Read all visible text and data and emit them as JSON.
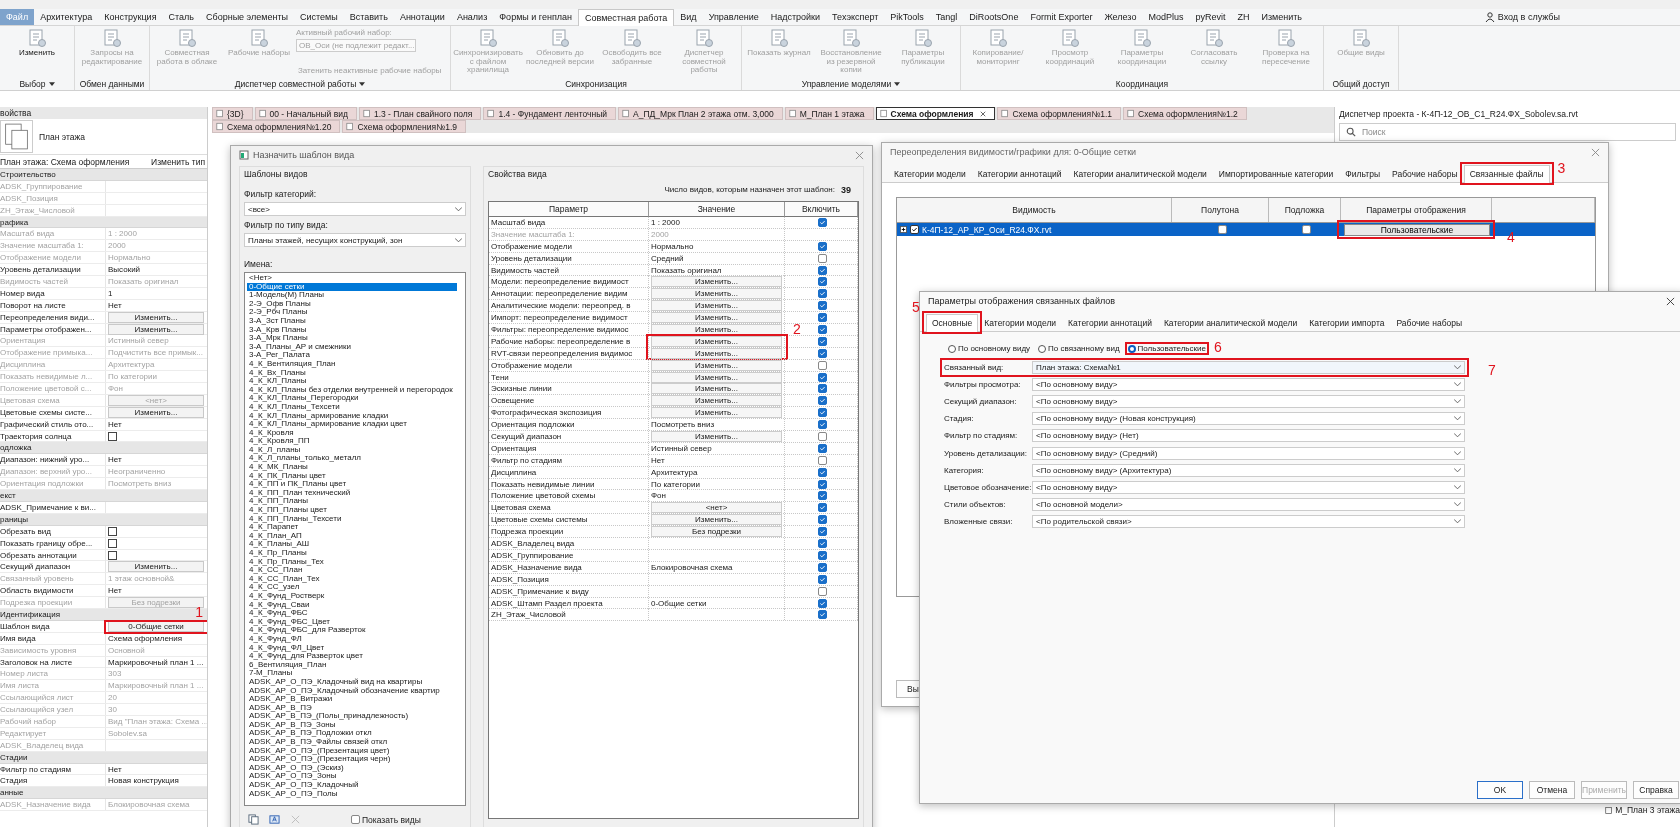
{
  "menu_tabs": [
    {
      "label": "Файл",
      "selected": false,
      "kind": "file"
    },
    {
      "label": "Архитектура",
      "selected": false,
      "kind": "tab"
    },
    {
      "label": "Конструкция",
      "selected": false,
      "kind": "tab"
    },
    {
      "label": "Сталь",
      "selected": false,
      "kind": "tab"
    },
    {
      "label": "Сборные элементы",
      "selected": false,
      "kind": "tab"
    },
    {
      "label": "Системы",
      "selected": false,
      "kind": "tab"
    },
    {
      "label": "Вставить",
      "selected": false,
      "kind": "tab"
    },
    {
      "label": "Аннотации",
      "selected": false,
      "kind": "tab"
    },
    {
      "label": "Анализ",
      "selected": false,
      "kind": "tab"
    },
    {
      "label": "Формы и генплан",
      "selected": false,
      "kind": "tab"
    },
    {
      "label": "Совместная работа",
      "selected": true,
      "kind": "tab"
    },
    {
      "label": "Вид",
      "selected": false,
      "kind": "tab"
    },
    {
      "label": "Управление",
      "selected": false,
      "kind": "tab"
    },
    {
      "label": "Надстройки",
      "selected": false,
      "kind": "tab"
    },
    {
      "label": "Техэксперт",
      "selected": false,
      "kind": "tab"
    },
    {
      "label": "PikTools",
      "selected": false,
      "kind": "tab"
    },
    {
      "label": "Tangl",
      "selected": false,
      "kind": "tab"
    },
    {
      "label": "DiRootsOne",
      "selected": false,
      "kind": "tab"
    },
    {
      "label": "Formit Exporter",
      "selected": false,
      "kind": "tab"
    },
    {
      "label": "Железо",
      "selected": false,
      "kind": "tab"
    },
    {
      "label": "ModPlus",
      "selected": false,
      "kind": "tab"
    },
    {
      "label": "pyRevit",
      "selected": false,
      "kind": "tab"
    },
    {
      "label": "ZH",
      "selected": false,
      "kind": "tab"
    },
    {
      "label": "Изменить",
      "selected": false,
      "kind": "tab"
    }
  ],
  "account": "Вход в службы",
  "ribbon_panels": [
    {
      "label": "Выбор",
      "menu": true,
      "items": [
        {
          "kind": "button",
          "label": "Изменить",
          "disabled": false
        }
      ]
    },
    {
      "label": "Обмен данными",
      "menu": false,
      "items": [
        {
          "kind": "button",
          "label": "Запросы на редактирование",
          "disabled": true
        }
      ]
    },
    {
      "label": "Диспетчер совместной работы",
      "menu": true,
      "items": [
        {
          "kind": "button",
          "label": "Совместная работа в облаке",
          "disabled": true
        },
        {
          "kind": "button",
          "label": "Рабочие наборы",
          "disabled": true
        },
        {
          "kind": "combo",
          "label": "Активный рабочий набор:",
          "value": "ОВ_Оси (не подлежит редакт...",
          "disabled": true
        },
        {
          "kind": "toggle",
          "label": "Затенить неактивные рабочие наборы",
          "disabled": true
        }
      ]
    },
    {
      "label": "Синхронизация",
      "menu": false,
      "items": [
        {
          "kind": "button",
          "label": "Синхронизировать с файлом хранилища",
          "disabled": true
        },
        {
          "kind": "button",
          "label": "Обновить до последней версии",
          "disabled": true
        },
        {
          "kind": "button",
          "label": "Освободить все забранные",
          "disabled": true
        },
        {
          "kind": "button",
          "label": "Диспетчер совместной работы",
          "disabled": true
        }
      ]
    },
    {
      "label": "Управление моделями",
      "menu": true,
      "items": [
        {
          "kind": "button",
          "label": "Показать журнал",
          "disabled": true
        },
        {
          "kind": "button",
          "label": "Восстановление из резервной копии",
          "disabled": true
        },
        {
          "kind": "button",
          "label": "Параметры публикации",
          "disabled": true
        }
      ]
    },
    {
      "label": "Координация",
      "menu": false,
      "items": [
        {
          "kind": "button",
          "label": "Копирование/мониторинг",
          "disabled": true
        },
        {
          "kind": "button",
          "label": "Просмотр координаций",
          "disabled": true
        },
        {
          "kind": "button",
          "label": "Параметры координации",
          "disabled": true
        },
        {
          "kind": "button",
          "label": "Согласовать ссылку",
          "disabled": true
        },
        {
          "kind": "button",
          "label": "Проверка на пересечение",
          "disabled": true
        }
      ]
    },
    {
      "label": "Общий доступ",
      "menu": false,
      "items": [
        {
          "kind": "button",
          "label": "Общие виды",
          "disabled": true
        }
      ]
    }
  ],
  "properties": {
    "title": "войства",
    "type_name": "План этажа",
    "instance": "План этажа: Схема оформления",
    "edit_type": "Изменить тип",
    "groups": [
      {
        "title": "Строительство",
        "rows": [
          {
            "name": "ADSK_Группирование",
            "kind": "text",
            "disabled": true
          },
          {
            "name": "ADSK_Позиция",
            "kind": "text",
            "disabled": true
          },
          {
            "name": "ZH_Этаж_Числовой",
            "kind": "text",
            "disabled": true
          }
        ]
      },
      {
        "title": "рафика",
        "rows": [
          {
            "name": "Масштаб вида",
            "kind": "text",
            "value": "1 : 2000",
            "disabled": true
          },
          {
            "name": "Значение масштаба    1:",
            "kind": "text",
            "value": "2000",
            "disabled": true
          },
          {
            "name": "Отображение модели",
            "kind": "text",
            "value": "Нормально",
            "disabled": true
          },
          {
            "name": "Уровень детализации",
            "kind": "text",
            "value": "Высокий",
            "disabled": false
          },
          {
            "name": "Видимость частей",
            "kind": "text",
            "value": "Показать оригинал",
            "disabled": true
          },
          {
            "name": "Номер вида",
            "kind": "text",
            "value": "1",
            "disabled": false
          },
          {
            "name": "Поворот на листе",
            "kind": "text",
            "value": "Нет",
            "disabled": false
          },
          {
            "name": "Переопределения види...",
            "kind": "button",
            "value": "Изменить...",
            "disabled": false
          },
          {
            "name": "Параметры отображен...",
            "kind": "button",
            "value": "Изменить...",
            "disabled": false
          },
          {
            "name": "Ориентация",
            "kind": "text",
            "value": "Истинный север",
            "disabled": true
          },
          {
            "name": "Отображение примыка...",
            "kind": "text",
            "value": "Подчистить все примык...",
            "disabled": true
          },
          {
            "name": "Дисциплина",
            "kind": "text",
            "value": "Архитектура",
            "disabled": true
          },
          {
            "name": "Показать невидимые л...",
            "kind": "text",
            "value": "По категории",
            "disabled": true
          },
          {
            "name": "Положение цветовой с...",
            "kind": "text",
            "value": "Фон",
            "disabled": true
          },
          {
            "name": "Цветовая схема",
            "kind": "button",
            "value": "<нет>",
            "disabled": true
          },
          {
            "name": "Цветовые схемы систе...",
            "kind": "button",
            "value": "Изменить...",
            "disabled": false
          },
          {
            "name": "Графический стиль ото...",
            "kind": "text",
            "value": "Нет",
            "disabled": false
          },
          {
            "name": "Траектория солнца",
            "kind": "check",
            "checked": false,
            "disabled": false
          }
        ]
      },
      {
        "title": "одложка",
        "rows": [
          {
            "name": "Диапазон: нижний уро...",
            "kind": "text",
            "value": "Нет",
            "disabled": false
          },
          {
            "name": "Диапазон: верхний уро...",
            "kind": "text",
            "value": "Неограниченно",
            "disabled": true
          },
          {
            "name": "Ориентация подложки",
            "kind": "text",
            "value": "Посмотреть вниз",
            "disabled": true
          }
        ]
      },
      {
        "title": "екст",
        "rows": [
          {
            "name": "ADSK_Примечание к ви...",
            "kind": "text",
            "disabled": false
          }
        ]
      },
      {
        "title": "раницы",
        "rows": [
          {
            "name": "Обрезать вид",
            "kind": "check",
            "checked": false,
            "disabled": false
          },
          {
            "name": "Показать границу обре...",
            "kind": "check",
            "checked": false,
            "disabled": false
          },
          {
            "name": "Обрезать аннотации",
            "kind": "check",
            "checked": false,
            "disabled": false
          },
          {
            "name": "Секущий диапазон",
            "kind": "button",
            "value": "Изменить...",
            "disabled": false
          },
          {
            "name": "Связанный уровень",
            "kind": "text",
            "value": "1 этаж основной&",
            "disabled": true
          },
          {
            "name": "Область видимости",
            "kind": "text",
            "value": "Нет",
            "disabled": false
          },
          {
            "name": "Подрезка проекции",
            "kind": "button",
            "value": "Без подрезки",
            "disabled": true
          }
        ]
      },
      {
        "title": "Идентификация",
        "rows": [
          {
            "name": "Шаблон вида",
            "kind": "button",
            "value": "0-Общие сетки",
            "disabled": false
          },
          {
            "name": "Имя вида",
            "kind": "text",
            "value": "Схема оформления",
            "disabled": false
          },
          {
            "name": "Зависимость уровня",
            "kind": "text",
            "value": "Основной",
            "disabled": true
          },
          {
            "name": "Заголовок на листе",
            "kind": "text",
            "value": "Маркировочный план 1 ...",
            "disabled": false
          },
          {
            "name": "Номер листа",
            "kind": "text",
            "value": "303",
            "disabled": true
          },
          {
            "name": "Имя листа",
            "kind": "text",
            "value": "Маркировочный план 1 ...",
            "disabled": true
          },
          {
            "name": "Ссылающийся лист",
            "kind": "text",
            "value": "20",
            "disabled": true
          },
          {
            "name": "Ссылающийся узел",
            "kind": "text",
            "value": "30",
            "disabled": true
          },
          {
            "name": "Рабочий набор",
            "kind": "text",
            "value": "Вид \"План этажа: Схема ...",
            "disabled": true
          },
          {
            "name": "Редактирует",
            "kind": "text",
            "value": "Sobolev.sa",
            "disabled": true
          },
          {
            "name": "ADSK_Владелец вида",
            "kind": "text",
            "disabled": true
          }
        ]
      },
      {
        "title": "Стадии",
        "rows": [
          {
            "name": "Фильтр по стадиям",
            "kind": "text",
            "value": "Нет",
            "disabled": false
          },
          {
            "name": "Стадия",
            "kind": "text",
            "value": "Новая конструкция",
            "disabled": false
          }
        ]
      },
      {
        "title": "анные",
        "rows": [
          {
            "name": "ADSK_Назначение вида",
            "kind": "text",
            "value": "Блокировочная схема",
            "disabled": true
          }
        ]
      }
    ]
  },
  "view_tab_rows": [
    {
      "tabs": [
        {
          "label": "{3D}",
          "selected": false
        },
        {
          "label": "00 - Начальный вид",
          "selected": false
        },
        {
          "label": "1.3 - План свайного поля",
          "selected": false
        },
        {
          "label": "1.4 - Фундамент ленточный",
          "selected": false
        },
        {
          "label": "А_ПД_Мрк План 2 этажа отм. 3,000",
          "selected": false
        },
        {
          "label": "М_План 1 этажа",
          "selected": false
        },
        {
          "label": "Схема оформления",
          "selected": true
        },
        {
          "label": "Схема оформления№1.1",
          "selected": false
        },
        {
          "label": "Схема оформления№1.2",
          "selected": false
        }
      ]
    },
    {
      "tabs": [
        {
          "label": "Схема оформления№1.20",
          "selected": false
        },
        {
          "label": "Схема оформления№1.9",
          "selected": false
        }
      ]
    }
  ],
  "project_browser": {
    "title": "Диспетчер проекта - К-4П-12_ОВ_С1_R24.ФХ_Sobolev.sa.rvt",
    "search": {
      "placeholder": "Поиск"
    },
    "items": [
      {
        "label": "М_План 3 этажа"
      }
    ]
  },
  "assign_template_dialog": {
    "title": "Назначить шаблон вида",
    "templates_group": "Шаблоны видов",
    "category_filter_label": "Фильтр категорий:",
    "category_filter": "<все>",
    "view_type_filter_label": "Фильтр по типу вида:",
    "view_type_filter": "Планы этажей, несущих конструкций, зон",
    "names_label": "Имена:",
    "names": [
      {
        "name": "<Нет>",
        "selected": false
      },
      {
        "name": "0-Общие сетки",
        "selected": true
      },
      {
        "name": "1-Модель(М) Планы",
        "selected": false
      },
      {
        "name": "2-Э_Офв Планы",
        "selected": false
      },
      {
        "name": "2-Э_Рбч Планы",
        "selected": false
      },
      {
        "name": "3-А_Зст Планы",
        "selected": false
      },
      {
        "name": "3-А_Крв Планы",
        "selected": false
      },
      {
        "name": "3-А_Мрк Планы",
        "selected": false
      },
      {
        "name": "3-А_Планы_АР и смежники",
        "selected": false
      },
      {
        "name": "3-А_Рег_Палата",
        "selected": false
      },
      {
        "name": "4_К_Вентиляция_План",
        "selected": false
      },
      {
        "name": "4_К_Вх_Планы",
        "selected": false
      },
      {
        "name": "4_К_КЛ_Планы",
        "selected": false
      },
      {
        "name": "4_К_КЛ_Планы без отделки внутренней и перегородок",
        "selected": false
      },
      {
        "name": "4_К_КЛ_Планы_Перегородки",
        "selected": false
      },
      {
        "name": "4_К_КЛ_Планы_Техсети",
        "selected": false
      },
      {
        "name": "4_К_КЛ_Планы_армирование кладки",
        "selected": false
      },
      {
        "name": "4_К_КЛ_Планы_армирование кладки цвет",
        "selected": false
      },
      {
        "name": "4_К_Кровля",
        "selected": false
      },
      {
        "name": "4_К_Кровля_ПП",
        "selected": false
      },
      {
        "name": "4_К_Л_планы",
        "selected": false
      },
      {
        "name": "4_К_Л_планы_только_металл",
        "selected": false
      },
      {
        "name": "4_К_МК_Планы",
        "selected": false
      },
      {
        "name": "4_К_ПК_Планы цвет",
        "selected": false
      },
      {
        "name": "4_К_ПП и ПК_Планы цвет",
        "selected": false
      },
      {
        "name": "4_К_ПП_План технический",
        "selected": false
      },
      {
        "name": "4_К_ПП_Планы",
        "selected": false
      },
      {
        "name": "4_К_ПП_Планы цвет",
        "selected": false
      },
      {
        "name": "4_К_ПП_Планы_Техсети",
        "selected": false
      },
      {
        "name": "4_К_Парапет",
        "selected": false
      },
      {
        "name": "4_К_План_АП",
        "selected": false
      },
      {
        "name": "4_К_Планы_АШ",
        "selected": false
      },
      {
        "name": "4_К_Пр_Планы",
        "selected": false
      },
      {
        "name": "4_К_Пр_Планы_Тех",
        "selected": false
      },
      {
        "name": "4_К_СС_План",
        "selected": false
      },
      {
        "name": "4_К_СС_План_Тех",
        "selected": false
      },
      {
        "name": "4_К_СС_узел",
        "selected": false
      },
      {
        "name": "4_К_Фунд_Ростверк",
        "selected": false
      },
      {
        "name": "4_К_Фунд_Сваи",
        "selected": false
      },
      {
        "name": "4_К_Фунд_ФБС",
        "selected": false
      },
      {
        "name": "4_К_Фунд_ФБС_Цвет",
        "selected": false
      },
      {
        "name": "4_К_Фунд_ФБС_для Разверток",
        "selected": false
      },
      {
        "name": "4_К_Фунд_ФЛ",
        "selected": false
      },
      {
        "name": "4_К_Фунд_ФЛ_Цвет",
        "selected": false
      },
      {
        "name": "4_К_Фунд_для Разверток цвет",
        "selected": false
      },
      {
        "name": "6_Вентиляция_План",
        "selected": false
      },
      {
        "name": "7-М_Планы",
        "selected": false
      },
      {
        "name": "ADSK_АР_О_ПЭ_Кладочный вид на квартиры",
        "selected": false
      },
      {
        "name": "ADSK_АР_О_ПЭ_Кладочный обозначение квартир",
        "selected": false
      },
      {
        "name": "ADSK_АР_В_Витражи",
        "selected": false
      },
      {
        "name": "ADSK_АР_В_ПЭ",
        "selected": false
      },
      {
        "name": "ADSK_АР_В_ПЭ_(Полы_принадлежность)",
        "selected": false
      },
      {
        "name": "ADSK_АР_В_ПЭ_Зоны",
        "selected": false
      },
      {
        "name": "ADSK_АР_В_ПЭ_Подложки откл",
        "selected": false
      },
      {
        "name": "ADSK_АР_В_ПЭ_Файлы связей откл",
        "selected": false
      },
      {
        "name": "ADSK_АР_О_ПЭ_(Презентация цвет)",
        "selected": false
      },
      {
        "name": "ADSK_АР_О_ПЭ_(Презентация черн)",
        "selected": false
      },
      {
        "name": "ADSK_АР_О_ПЭ_(Эскиз)",
        "selected": false
      },
      {
        "name": "ADSK_АР_О_ПЭ_Зоны",
        "selected": false
      },
      {
        "name": "ADSK_АР_О_ПЭ_Кладочный",
        "selected": false
      },
      {
        "name": "ADSK_АР_О_ПЭ_Полы",
        "selected": false
      }
    ],
    "show_views": {
      "label": "Показать виды",
      "checked": false
    },
    "properties_group": "Свойства вида",
    "count_label": "Число видов, которым назначен этот шаблон:",
    "count": "39",
    "columns": [
      "Параметр",
      "Значение",
      "Включить"
    ],
    "rows": [
      {
        "parameter": "Масштаб вида",
        "kind": "text",
        "value": "1 : 2000",
        "disabled": false,
        "included": true
      },
      {
        "parameter": "Значение масштаба    1:",
        "kind": "text",
        "value": "2000",
        "disabled": true
      },
      {
        "parameter": "Отображение модели",
        "kind": "text",
        "value": "Нормально",
        "disabled": false,
        "included": true
      },
      {
        "parameter": "Уровень детализации",
        "kind": "text",
        "value": "Средний",
        "disabled": false,
        "included": false
      },
      {
        "parameter": "Видимость частей",
        "kind": "text",
        "value": "Показать оригинал",
        "disabled": false,
        "included": true
      },
      {
        "parameter": "Модели: переопределение видимост",
        "kind": "button",
        "value": "Изменить...",
        "disabled": false,
        "included": true
      },
      {
        "parameter": "Аннотации: переопределение видим",
        "kind": "button",
        "value": "Изменить...",
        "disabled": false,
        "included": true
      },
      {
        "parameter": "Аналитические модели: переопред. в",
        "kind": "button",
        "value": "Изменить...",
        "disabled": false,
        "included": true
      },
      {
        "parameter": "Импорт: переопределение видимост",
        "kind": "button",
        "value": "Изменить...",
        "disabled": false,
        "included": true
      },
      {
        "parameter": "Фильтры: переопределение видимос",
        "kind": "button",
        "value": "Изменить...",
        "disabled": false,
        "included": true
      },
      {
        "parameter": "Рабочие наборы: переопределение в",
        "kind": "button",
        "value": "Изменить...",
        "disabled": false,
        "included": true
      },
      {
        "parameter": "RVT-связи переопределения видимос",
        "kind": "button",
        "value": "Изменить...",
        "disabled": false,
        "included": true
      },
      {
        "parameter": "Отображение модели",
        "kind": "button",
        "value": "Изменить...",
        "disabled": false,
        "included": false
      },
      {
        "parameter": "Тени",
        "kind": "button",
        "value": "Изменить...",
        "disabled": false,
        "included": true
      },
      {
        "parameter": "Эскизные линии",
        "kind": "button",
        "value": "Изменить...",
        "disabled": false,
        "included": true
      },
      {
        "parameter": "Освещение",
        "kind": "button",
        "value": "Изменить...",
        "disabled": false,
        "included": true
      },
      {
        "parameter": "Фотографическая экспозиция",
        "kind": "button",
        "value": "Изменить...",
        "disabled": false,
        "included": true
      },
      {
        "parameter": "Ориентация подложки",
        "kind": "text",
        "value": "Посмотреть вниз",
        "disabled": false,
        "included": true
      },
      {
        "parameter": "Секущий диапазон",
        "kind": "button",
        "value": "Изменить...",
        "disabled": false,
        "included": false
      },
      {
        "parameter": "Ориентация",
        "kind": "text",
        "value": "Истинный север",
        "disabled": false,
        "included": true
      },
      {
        "parameter": "Фильтр по стадиям",
        "kind": "text",
        "value": "Нет",
        "disabled": false,
        "included": false
      },
      {
        "parameter": "Дисциплина",
        "kind": "text",
        "value": "Архитектура",
        "disabled": false,
        "included": true
      },
      {
        "parameter": "Показать невидимые линии",
        "kind": "text",
        "value": "По категории",
        "disabled": false,
        "included": true
      },
      {
        "parameter": "Положение цветовой схемы",
        "kind": "text",
        "value": "Фон",
        "disabled": false,
        "included": true
      },
      {
        "parameter": "Цветовая схема",
        "kind": "button",
        "value": "<нет>",
        "disabled": false,
        "included": true
      },
      {
        "parameter": "Цветовые схемы системы",
        "kind": "button",
        "value": "Изменить...",
        "disabled": false,
        "included": true
      },
      {
        "parameter": "Подрезка проекции",
        "kind": "button",
        "value": "Без подрезки",
        "disabled": false,
        "included": true
      },
      {
        "parameter": "ADSK_Владелец вида",
        "kind": "text",
        "disabled": false,
        "included": true
      },
      {
        "parameter": "ADSK_Группирование",
        "kind": "text",
        "disabled": false,
        "included": true
      },
      {
        "parameter": "ADSK_Назначение вида",
        "kind": "text",
        "value": "Блокировочная схема",
        "disabled": false,
        "included": true
      },
      {
        "parameter": "ADSK_Позиция",
        "kind": "text",
        "disabled": false,
        "included": true
      },
      {
        "parameter": "ADSK_Примечание к виду",
        "kind": "text",
        "disabled": false,
        "included": false
      },
      {
        "parameter": "ADSK_Штамп Раздел проекта",
        "kind": "text",
        "value": "0-Общие сетки",
        "disabled": false,
        "included": true
      },
      {
        "parameter": "ZH_Этаж_Числовой",
        "kind": "text",
        "disabled": false,
        "included": true
      }
    ]
  },
  "vg_dialog": {
    "title": "Переопределения видимости/графики для: 0-Общие сетки",
    "tabs": [
      {
        "label": "Категории модели",
        "selected": false
      },
      {
        "label": "Категории аннотаций",
        "selected": false
      },
      {
        "label": "Категории аналитической модели",
        "selected": false
      },
      {
        "label": "Импортированные категории",
        "selected": false
      },
      {
        "label": "Фильтры",
        "selected": false
      },
      {
        "label": "Рабочие наборы",
        "selected": false
      },
      {
        "label": "Связанные файлы",
        "selected": true
      }
    ],
    "columns": [
      "Видимость",
      "Полутона",
      "Подложка",
      "Параметры отображения"
    ],
    "rows": [
      {
        "name": "К-4П-12_АР_КР_Оси_R24.ФХ.rvt",
        "selected": true,
        "visible": true,
        "halftone": false,
        "underlay": false,
        "display_settings": "Пользовательские"
      }
    ],
    "footer_button": "Вы"
  },
  "linked_dialog": {
    "title": "Параметры отображения связанных файлов",
    "tabs": [
      {
        "label": "Основные",
        "selected": true
      },
      {
        "label": "Категории модели",
        "selected": false
      },
      {
        "label": "Категории аннотаций",
        "selected": false
      },
      {
        "label": "Категории аналитической модели",
        "selected": false
      },
      {
        "label": "Категории импорта",
        "selected": false
      },
      {
        "label": "Рабочие наборы",
        "selected": false
      }
    ],
    "radios": [
      {
        "label": "По основному виду",
        "selected": false
      },
      {
        "label": "По связанному вид",
        "selected": false
      },
      {
        "label": "Пользовательские",
        "selected": true
      }
    ],
    "fields": [
      {
        "label": "Связанный вид:",
        "value": "План этажа: Схема№1"
      },
      {
        "label": "Фильтры просмотра:",
        "value": "<По основному виду>"
      },
      {
        "label": "Секущий диапазон:",
        "value": "<По основному виду>"
      },
      {
        "label": "Стадия:",
        "value": "<По основному виду> (Новая конструкция)"
      },
      {
        "label": "Фильтр по стадиям:",
        "value": "<По основному виду> (Нет)"
      },
      {
        "label": "Уровень детализации:",
        "value": "<По основному виду> (Средний)"
      },
      {
        "label": "Категория:",
        "value": "<По основному виду> (Архитектура)"
      },
      {
        "label": "Цветовое обозначение:",
        "value": "<По основному виду>"
      },
      {
        "label": "Стили объектов:",
        "value": "<По основной модели>"
      },
      {
        "label": "Вложенные связи:",
        "value": "<По родительской связи>"
      }
    ],
    "buttons": [
      {
        "label": "OK",
        "kind": "primary"
      },
      {
        "label": "Отмена",
        "kind": "normal"
      },
      {
        "label": "Применить",
        "kind": "disabled"
      },
      {
        "label": "Справка",
        "kind": "normal"
      }
    ]
  },
  "annotations": [
    {
      "label": "1"
    },
    {
      "label": "2"
    },
    {
      "label": "3"
    },
    {
      "label": "4"
    },
    {
      "label": "5"
    },
    {
      "label": "6"
    },
    {
      "label": "7"
    }
  ]
}
